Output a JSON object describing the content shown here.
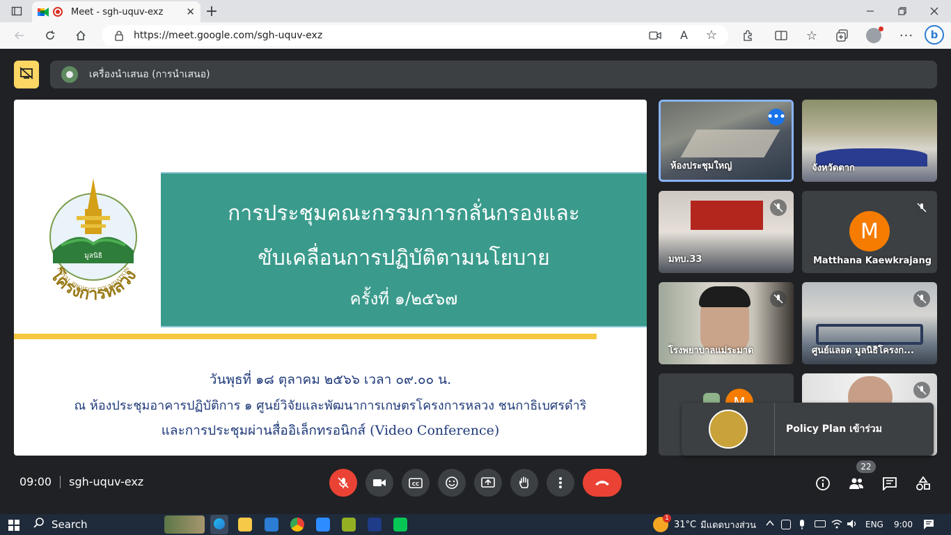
{
  "browser": {
    "tab_title": "Meet - sgh-uquv-exz",
    "url": "https://meet.google.com/sgh-uquv-exz",
    "read_aloud_label": "A"
  },
  "meet": {
    "presenter_label": "เครื่องนำเสนอ (การนำเสนอ)",
    "time": "09:00",
    "meeting_code": "sgh-uquv-exz",
    "participants_count": "22",
    "toast_text": "Policy Plan เข้าร่วม"
  },
  "slide": {
    "logo_text": "โครงการหลวง",
    "logo_subtitle": "ROYAL PROJECT FOUNDATION",
    "logo_inner_text": "มูลนิธิ",
    "title_line1": "การประชุมคณะกรรมการกลั่นกรองและ",
    "title_line2": "ขับเคลื่อนการปฏิบัติตามนโยบาย",
    "title_line3": "ครั้งที่ ๑/๒๕๖๗",
    "detail_line1": "วันพุธที่ ๑๘ ตุลาคม ๒๕๖๖ เวลา ๐๙.๐๐ น.",
    "detail_line2": "ณ ห้องประชุมอาคารปฏิบัติการ ๑ ศูนย์วิจัยและพัฒนาการเกษตรโครงการหลวง ชนกาธิเบศรดำริ",
    "detail_line3": "และการประชุมผ่านสื่ออิเล็กทรอนิกส์ (Video Conference)"
  },
  "tiles": [
    {
      "name": "ห้องประชุมใหญ่"
    },
    {
      "name": "จังหวัดตาก"
    },
    {
      "name": "มทบ.33"
    },
    {
      "name": "Matthana Kaewkrajang",
      "initial": "M"
    },
    {
      "name": "โรงพยาบาลแม่ระมาด"
    },
    {
      "name": "ศูนย์แลอต มูลนิธิโครงก..."
    },
    {
      "initial": "M"
    },
    {}
  ],
  "taskbar": {
    "search_label": "Search",
    "weather": "31°C",
    "weather_desc": "มีแดดบางส่วน",
    "weather_badge": "1",
    "lang": "ENG",
    "clock": "9:00"
  },
  "colors": {
    "meet_bg": "#202124",
    "end_call_red": "#ea4335",
    "slide_teal": "#3a9b8c",
    "slide_gold": "#f5c842",
    "slide_text": "#1f3a7a",
    "avatar_orange": "#f57c00",
    "present_toggle": "#fdd663"
  }
}
